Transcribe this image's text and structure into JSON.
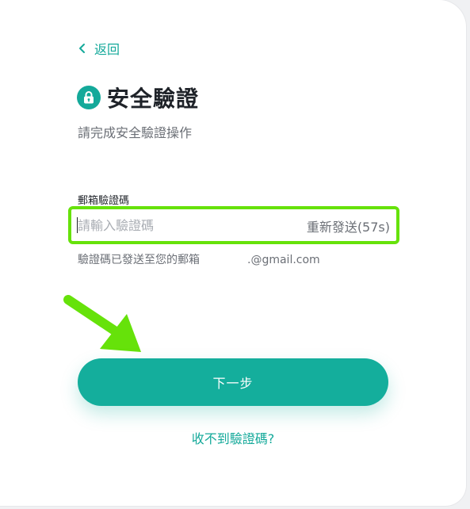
{
  "nav": {
    "back_label": "返回"
  },
  "header": {
    "title": "安全驗證",
    "subtitle": "請完成安全驗證操作"
  },
  "form": {
    "field_label": "郵箱驗證碼",
    "code_input": {
      "value": "",
      "placeholder": "請輸入驗證碼"
    },
    "resend_label": "重新發送(57s)",
    "hint_prefix": "驗證碼已發送至您的郵箱",
    "hint_suffix": ".@gmail.com"
  },
  "actions": {
    "next_label": "下一步",
    "no_code_label": "收不到驗證碼?"
  },
  "colors": {
    "accent": "#14ae9c",
    "highlight": "#66e20a"
  },
  "icons": {
    "back": "chevron-left-icon",
    "title": "lock-icon",
    "annotation": "arrow-pointer-icon"
  }
}
